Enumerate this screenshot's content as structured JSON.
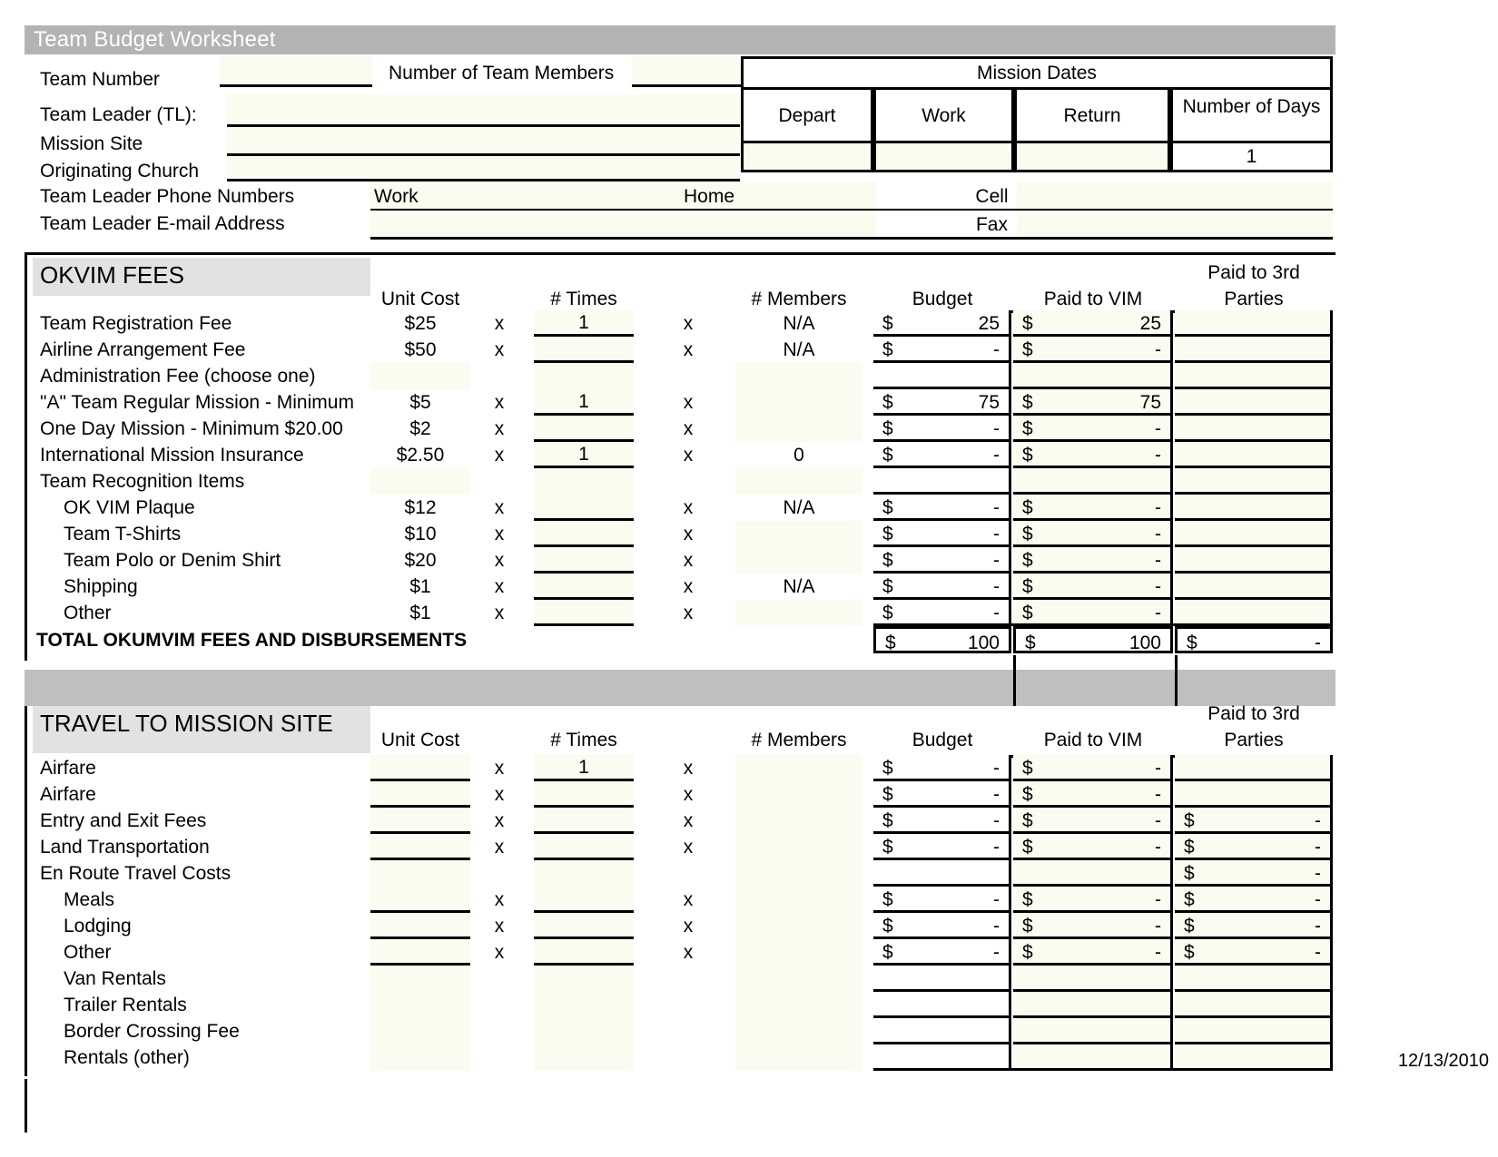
{
  "title": "Team Budget Worksheet",
  "header": {
    "team_number_label": "Team Number",
    "team_number_value": "",
    "num_members_label": "Number of Team Members",
    "num_members_value": "",
    "mission_dates_label": "Mission  Dates",
    "depart_label": "Depart",
    "work_label": "Work",
    "return_label": "Return",
    "num_days_label": "Number of Days",
    "depart_value": "",
    "work_value": "",
    "return_value": "",
    "num_days_value": "1",
    "team_leader_label": "Team Leader (TL):",
    "team_leader_value": "",
    "mission_site_label": "Mission Site",
    "mission_site_value": "",
    "originating_church_label": "Originating Church",
    "originating_church_value": "",
    "phone_numbers_label": "Team Leader Phone Numbers",
    "work_phone_label": "Work",
    "work_phone_value": "",
    "home_phone_label": "Home",
    "home_phone_value": "",
    "cell_phone_label": "Cell",
    "cell_phone_value": "",
    "email_label": "Team Leader E-mail Address",
    "email_value": "",
    "fax_label": "Fax",
    "fax_value": ""
  },
  "columns": {
    "unit_cost": "Unit Cost",
    "times": "# Times",
    "members": "# Members",
    "budget": "Budget",
    "paid_to_vim": "Paid to VIM",
    "paid_3rd_line1": "Paid to 3rd",
    "paid_3rd_line2": "Parties",
    "multiply": "x"
  },
  "okvim": {
    "section_title": "OKVIM FEES",
    "total_label": "TOTAL OKUMVIM FEES AND DISBURSEMENTS",
    "total_budget_sym": "$",
    "total_budget_val": "100",
    "total_vim_sym": "$",
    "total_vim_val": "100",
    "total_third_sym": "$",
    "total_third_val": "-",
    "rows": [
      {
        "label": "Team Registration Fee",
        "indent": 0,
        "unit": "$25",
        "times": "1",
        "members": "N/A",
        "budget_sym": "$",
        "budget": "25",
        "vim_sym": "$",
        "vim": "25",
        "third_sym": "",
        "third": "",
        "has_inputs": true
      },
      {
        "label": "Airline Arrangement Fee",
        "indent": 0,
        "unit": "$50",
        "times": "",
        "members": "N/A",
        "budget_sym": "$",
        "budget": "-",
        "vim_sym": "$",
        "vim": "-",
        "third_sym": "",
        "third": "",
        "has_inputs": true
      },
      {
        "label": "Administration Fee (choose one)",
        "indent": 0,
        "unit": "",
        "times": "",
        "members": "",
        "budget_sym": "",
        "budget": "",
        "vim_sym": "",
        "vim": "",
        "third_sym": "",
        "third": "",
        "has_inputs": false
      },
      {
        "label": "\"A\" Team Regular   Mission - Minimum",
        "indent": 0,
        "unit": "$5",
        "times": "1",
        "members": "",
        "budget_sym": "$",
        "budget": "75",
        "vim_sym": "$",
        "vim": "75",
        "third_sym": "",
        "third": "",
        "has_inputs": true
      },
      {
        "label": " One Day Mission - Minimum $20.00",
        "indent": 0,
        "unit": "$2",
        "times": "",
        "members": "",
        "budget_sym": "$",
        "budget": "-",
        "vim_sym": "$",
        "vim": "-",
        "third_sym": "",
        "third": "",
        "has_inputs": true
      },
      {
        "label": "International Mission Insurance",
        "indent": 0,
        "unit": "$2.50",
        "times": "1",
        "members": "0",
        "budget_sym": "$",
        "budget": "-",
        "vim_sym": "$",
        "vim": "-",
        "third_sym": "",
        "third": "",
        "has_inputs": true
      },
      {
        "label": "Team Recognition Items",
        "indent": 0,
        "unit": "",
        "times": "",
        "members": "",
        "budget_sym": "",
        "budget": "",
        "vim_sym": "",
        "vim": "",
        "third_sym": "",
        "third": "",
        "has_inputs": false
      },
      {
        "label": "OK VIM Plaque",
        "indent": 1,
        "unit": "$12",
        "times": "",
        "members": "N/A",
        "budget_sym": "$",
        "budget": "-",
        "vim_sym": "$",
        "vim": "-",
        "third_sym": "",
        "third": "",
        "has_inputs": true
      },
      {
        "label": "Team T-Shirts",
        "indent": 1,
        "unit": "$10",
        "times": "",
        "members": "",
        "budget_sym": "$",
        "budget": "-",
        "vim_sym": "$",
        "vim": "-",
        "third_sym": "",
        "third": "",
        "has_inputs": true
      },
      {
        "label": "Team Polo or Denim Shirt",
        "indent": 1,
        "unit": "$20",
        "times": "",
        "members": "",
        "budget_sym": "$",
        "budget": "-",
        "vim_sym": "$",
        "vim": "-",
        "third_sym": "",
        "third": "",
        "has_inputs": true
      },
      {
        "label": "Shipping",
        "indent": 1,
        "unit": "$1",
        "times": "",
        "members": "N/A",
        "budget_sym": "$",
        "budget": "-",
        "vim_sym": "$",
        "vim": "-",
        "third_sym": "",
        "third": "",
        "has_inputs": true
      },
      {
        "label": "Other",
        "indent": 1,
        "unit": "$1",
        "times": "",
        "members": "",
        "budget_sym": "$",
        "budget": "-",
        "vim_sym": "$",
        "vim": "-",
        "third_sym": "",
        "third": "",
        "has_inputs": true
      }
    ]
  },
  "travel": {
    "section_title": "TRAVEL TO MISSION SITE",
    "rows": [
      {
        "label": "Airfare",
        "indent": 0,
        "unit": "",
        "times": "1",
        "members": "",
        "budget_sym": "$",
        "budget": "-",
        "vim_sym": "$",
        "vim": "-",
        "third_sym": "",
        "third": "",
        "has_inputs": true
      },
      {
        "label": "Airfare",
        "indent": 0,
        "unit": "",
        "times": "",
        "members": "",
        "budget_sym": "$",
        "budget": "-",
        "vim_sym": "$",
        "vim": "-",
        "third_sym": "",
        "third": "",
        "has_inputs": true
      },
      {
        "label": "Entry and Exit Fees",
        "indent": 0,
        "unit": "",
        "times": "",
        "members": "",
        "budget_sym": "$",
        "budget": "-",
        "vim_sym": "$",
        "vim": "-",
        "third_sym": "$",
        "third": "-",
        "has_inputs": true
      },
      {
        "label": "Land Transportation",
        "indent": 0,
        "unit": "",
        "times": "",
        "members": "",
        "budget_sym": "$",
        "budget": "-",
        "vim_sym": "$",
        "vim": "-",
        "third_sym": "$",
        "third": "-",
        "has_inputs": true
      },
      {
        "label": "En Route Travel Costs",
        "indent": 0,
        "unit": "",
        "times": "",
        "members": "",
        "budget_sym": "",
        "budget": "",
        "vim_sym": "",
        "vim": "",
        "third_sym": "$",
        "third": "-",
        "has_inputs": false
      },
      {
        "label": "Meals",
        "indent": 1,
        "unit": "",
        "times": "",
        "members": "",
        "budget_sym": "$",
        "budget": "-",
        "vim_sym": "$",
        "vim": "-",
        "third_sym": "$",
        "third": "-",
        "has_inputs": true
      },
      {
        "label": "Lodging",
        "indent": 1,
        "unit": "",
        "times": "",
        "members": "",
        "budget_sym": "$",
        "budget": "-",
        "vim_sym": "$",
        "vim": "-",
        "third_sym": "$",
        "third": "-",
        "has_inputs": true
      },
      {
        "label": "Other",
        "indent": 1,
        "unit": "",
        "times": "",
        "members": "",
        "budget_sym": "$",
        "budget": "-",
        "vim_sym": "$",
        "vim": "-",
        "third_sym": "$",
        "third": "-",
        "has_inputs": true
      },
      {
        "label": "Van Rentals",
        "indent": 1,
        "unit": "",
        "times": "",
        "members": "",
        "budget_sym": "",
        "budget": "",
        "vim_sym": "",
        "vim": "",
        "third_sym": "",
        "third": "",
        "has_inputs": false
      },
      {
        "label": "Trailer Rentals",
        "indent": 1,
        "unit": "",
        "times": "",
        "members": "",
        "budget_sym": "",
        "budget": "",
        "vim_sym": "",
        "vim": "",
        "third_sym": "",
        "third": "",
        "has_inputs": false
      },
      {
        "label": "Border Crossing Fee",
        "indent": 1,
        "unit": "",
        "times": "",
        "members": "",
        "budget_sym": "",
        "budget": "",
        "vim_sym": "",
        "vim": "",
        "third_sym": "",
        "third": "",
        "has_inputs": false
      },
      {
        "label": "Rentals (other)",
        "indent": 1,
        "unit": "",
        "times": "",
        "members": "",
        "budget_sym": "",
        "budget": "",
        "vim_sym": "",
        "vim": "",
        "third_sym": "",
        "third": "",
        "has_inputs": false
      }
    ]
  },
  "footer": {
    "date": "12/13/2010"
  },
  "colors": {
    "title_bar": "#b3b3b3",
    "section_band": "#bfbfbf",
    "section_label": "#e2e2e2",
    "input_fill": "#fcfbf0",
    "grid_line": "#000000"
  }
}
